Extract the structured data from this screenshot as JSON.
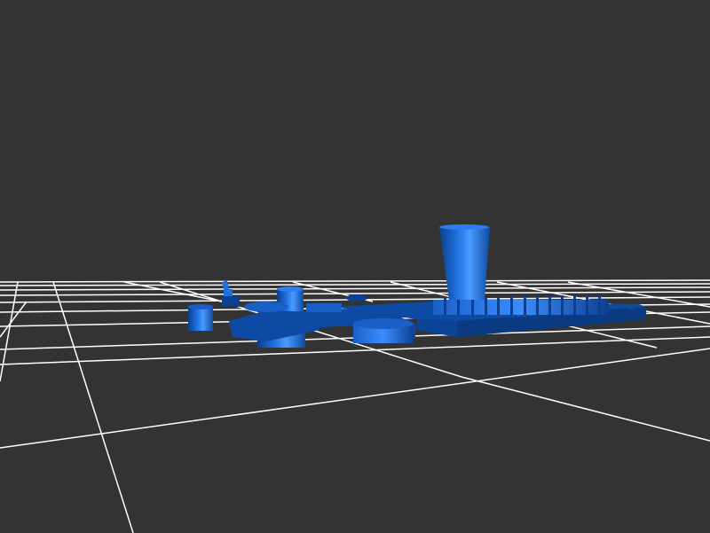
{
  "viewer": {
    "background_color": "#333333",
    "grid_color": "#ffffff",
    "model_color": "#1f6fe0",
    "model_shade_color": "#0b3f8a",
    "model_highlight_color": "#3d93ff"
  }
}
